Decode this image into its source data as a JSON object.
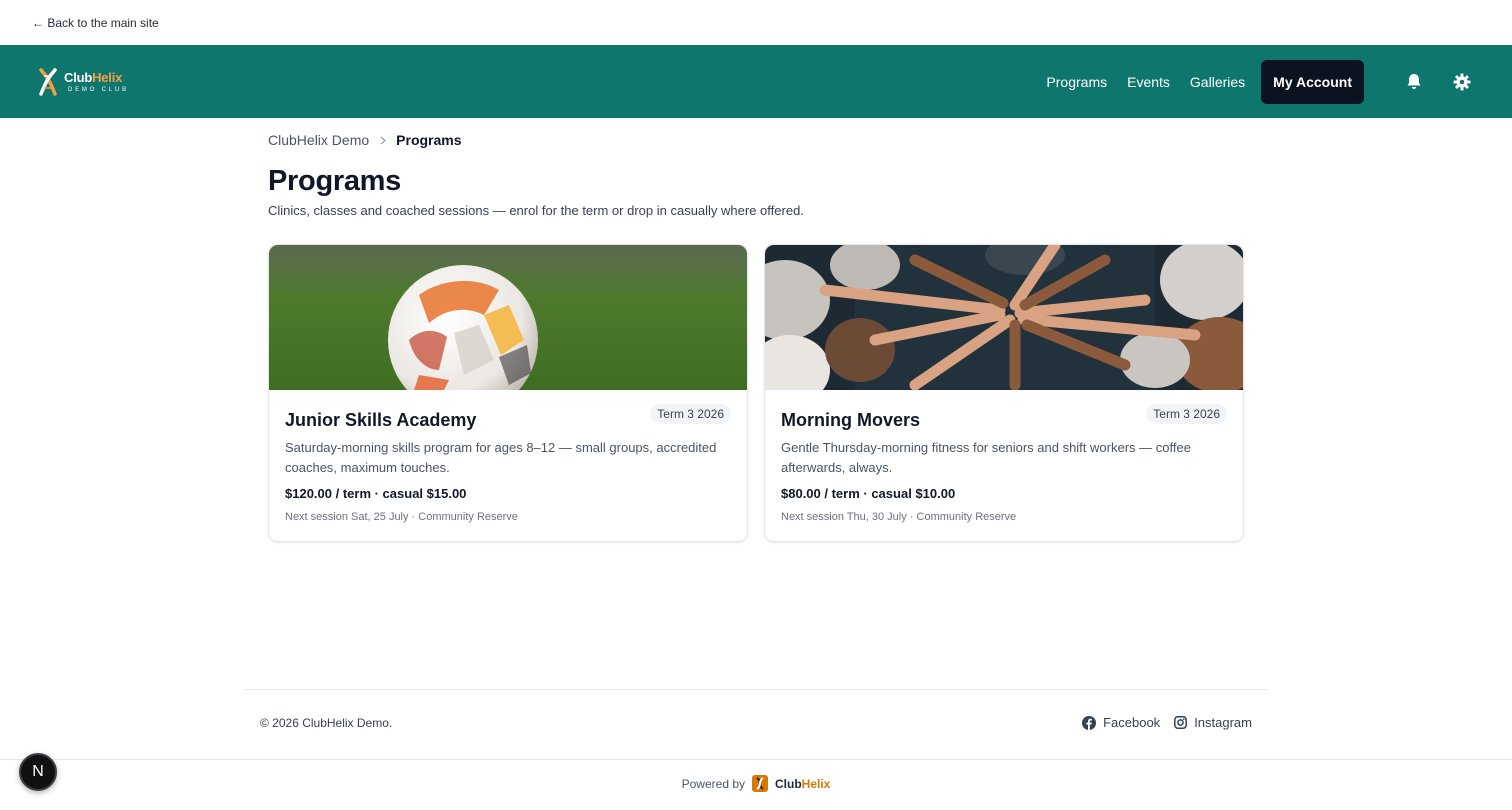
{
  "topbar": {
    "back_label": "← Back to the main site"
  },
  "navbar": {
    "logo": {
      "name_main": "Club",
      "name_accent": "Helix",
      "subtitle": "DEMO CLUB"
    },
    "links": [
      "Programs",
      "Events",
      "Galleries"
    ],
    "account_label": "My Account",
    "icons": [
      "bell-icon",
      "gear-icon"
    ],
    "bg_color": "#0f766e"
  },
  "breadcrumb": {
    "root": "ClubHelix Demo",
    "current": "Programs"
  },
  "page": {
    "title": "Programs",
    "subtitle": "Clinics, classes and coached sessions — enrol for the term or drop in casually where offered."
  },
  "programs": [
    {
      "title": "Junior Skills Academy",
      "badge": "Term 3 2026",
      "description": "Saturday-morning skills program for ages 8–12 — small groups, accredited coaches, maximum touches.",
      "price": "$120.00 / term · casual $15.00",
      "next": "Next session Sat, 25 July · Community Reserve"
    },
    {
      "title": "Morning Movers",
      "badge": "Term 3 2026",
      "description": "Gentle Thursday-morning fitness for seniors and shift workers — coffee afterwards, always.",
      "price": "$80.00 / term · casual $10.00",
      "next": "Next session Thu, 30 July · Community Reserve"
    }
  ],
  "footer": {
    "copyright": "© 2026 ClubHelix Demo.",
    "social": [
      "Facebook",
      "Instagram"
    ]
  },
  "powered": {
    "label": "Powered by",
    "brand_main": "Club",
    "brand_accent": "Helix"
  },
  "dev_badge": "N"
}
